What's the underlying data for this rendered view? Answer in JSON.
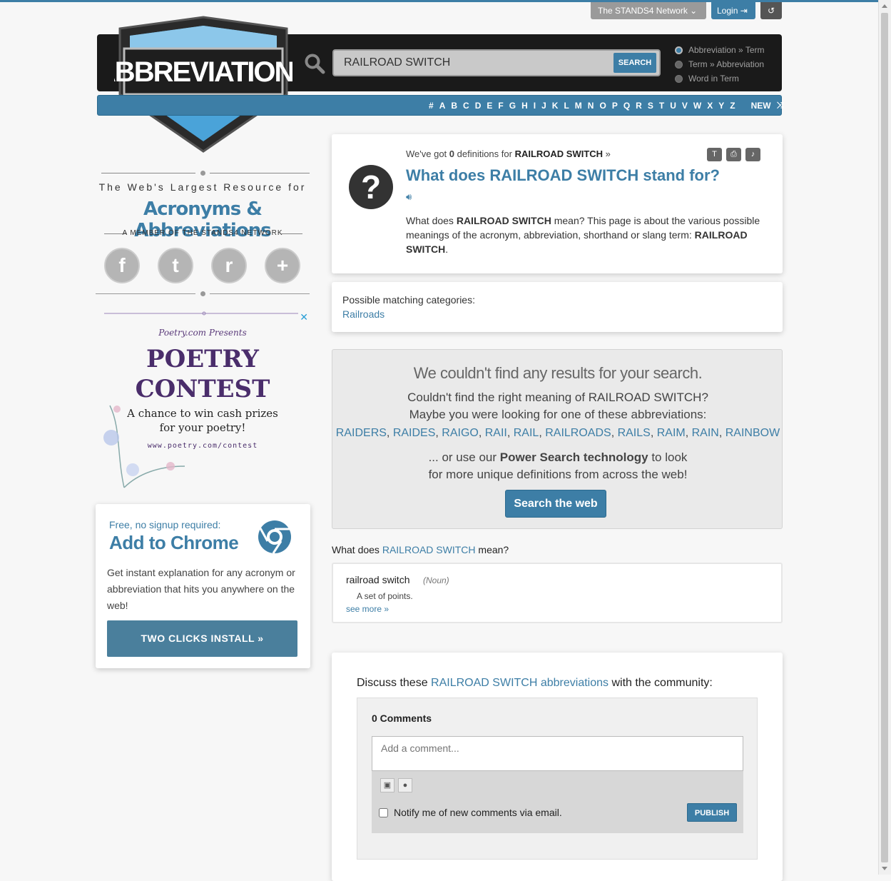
{
  "network": {
    "stands4_label": "The STANDS4 Network",
    "login_label": "Login"
  },
  "header": {
    "logo_text": "ABBREVIATIONS",
    "search_value": "RAILROAD SWITCH",
    "search_button": "SEARCH",
    "modes": [
      {
        "label": "Abbreviation » Term",
        "selected": true
      },
      {
        "label": "Term » Abbreviation",
        "selected": false
      },
      {
        "label": "Word in Term",
        "selected": false
      }
    ]
  },
  "alphabet": [
    "#",
    "A",
    "B",
    "C",
    "D",
    "E",
    "F",
    "G",
    "H",
    "I",
    "J",
    "K",
    "L",
    "M",
    "N",
    "O",
    "P",
    "Q",
    "R",
    "S",
    "T",
    "U",
    "V",
    "W",
    "X",
    "Y",
    "Z"
  ],
  "alphabet_new": "NEW",
  "sidebar": {
    "tagline1": "The Web's Largest Resource for",
    "tagline2": "Acronyms & Abbreviations",
    "tagline3": "A MEMBER OF THE STANDS4 NETWORK",
    "social": [
      "f",
      "t",
      "r",
      "+"
    ],
    "ad": {
      "presents": "Poetry.com Presents",
      "title_line1": "POETRY",
      "title_line2": "CONTEST",
      "sub_line1": "A chance to win cash prizes",
      "sub_line2": "for your poetry!",
      "url": "www.poetry.com/contest",
      "close": "✕"
    },
    "chrome": {
      "free": "Free, no signup required:",
      "add": "Add to Chrome",
      "desc": "Get instant explanation for any acronym or abbreviation that hits you anywhere on the web!",
      "install": "TWO CLICKS INSTALL »"
    }
  },
  "main": {
    "got_prefix": "We've got ",
    "got_count": "0",
    "got_mid": " definitions for ",
    "got_term": "RAILROAD SWITCH",
    "got_suffix": " »",
    "title": "What does RAILROAD SWITCH stand for?",
    "body_1": "What does ",
    "body_term": "RAILROAD SWITCH",
    "body_2": " mean? This page is about the various possible meanings of the acronym, abbreviation, shorthand or slang term: ",
    "body_term2": "RAILROAD SWITCH",
    "body_3": ".",
    "categories_label": "Possible matching categories:",
    "category": "Railroads",
    "noresult_heading": "We couldn't find any results for your search.",
    "noresult_line1": "Couldn't find the right meaning of RAILROAD SWITCH?",
    "noresult_line2": "Maybe you were looking for one of these abbreviations:",
    "suggestions": [
      "RAIDERS",
      "RAIDES",
      "RAIGO",
      "RAII",
      "RAIL",
      "RAILROADS",
      "RAILS",
      "RAIM",
      "RAIN",
      "RAINBOW"
    ],
    "power_pre": "... or use our ",
    "power_bold": "Power Search technology",
    "power_post": " to look",
    "power_line2": "for more unique definitions from across the web!",
    "search_web": "Search the web",
    "mean_pre": "What does ",
    "mean_term": "RAILROAD SWITCH",
    "mean_post": " mean?",
    "def_word": "railroad switch",
    "def_pos": "(Noun)",
    "def_text": "A set of points.",
    "see_more": "see more »",
    "discuss_pre": "Discuss these ",
    "discuss_link": "RAILROAD SWITCH abbreviations",
    "discuss_post": " with the community:",
    "comments_count": "0 Comments",
    "comment_placeholder": "Add a comment...",
    "notify": "Notify me of new comments via email.",
    "publish": "PUBLISH"
  }
}
